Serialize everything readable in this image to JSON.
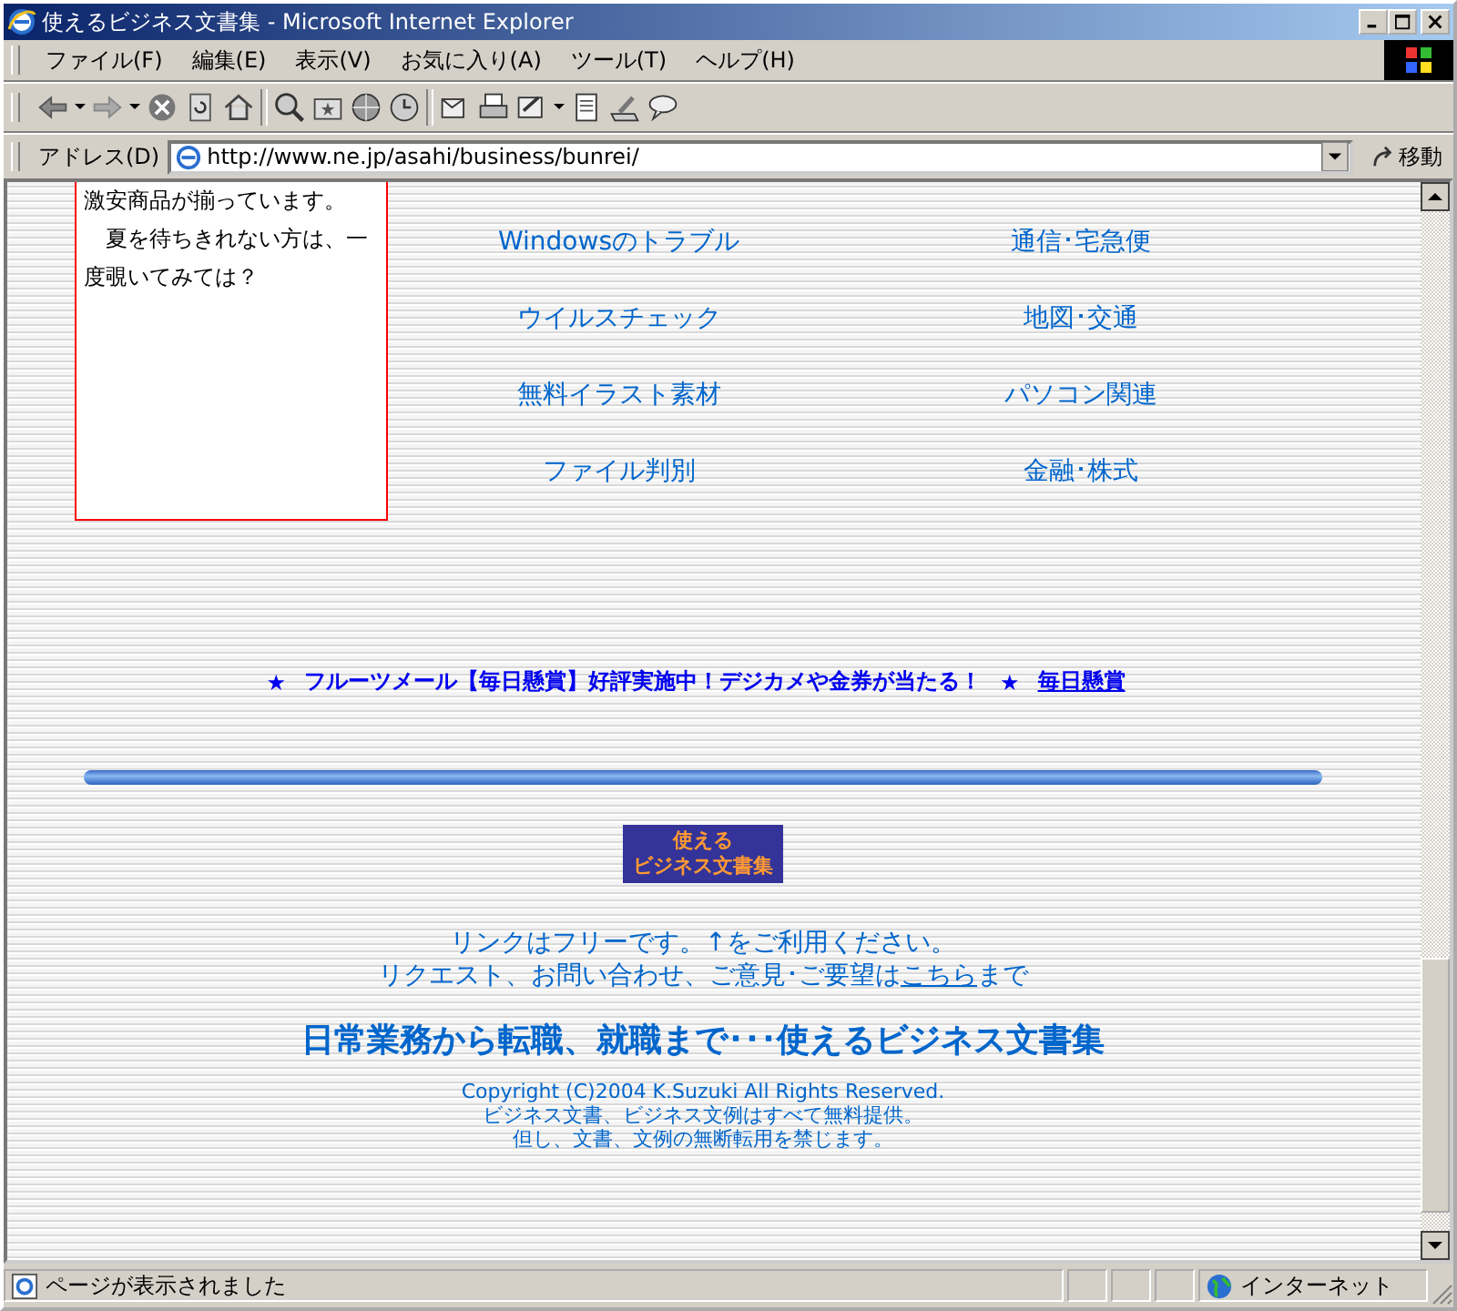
{
  "window": {
    "title": "使えるビジネス文書集 - Microsoft Internet Explorer"
  },
  "menu": [
    "ファイル(F)",
    "編集(E)",
    "表示(V)",
    "お気に入り(A)",
    "ツール(T)",
    "ヘルプ(H)"
  ],
  "address_bar": {
    "label": "アドレス(D)",
    "url": "http://www.ne.jp/asahi/business/bunrei/",
    "go": "移動"
  },
  "sidebar_note": [
    "激安商品が揃っています。",
    "　夏を待ちきれない方は、一度覗いてみては？"
  ],
  "links": [
    "Windowsのトラブル",
    "通信･宅急便",
    "ウイルスチェック",
    "地図･交通",
    "無料イラスト素材",
    "パソコン関連",
    "ファイル判別",
    "金融･株式"
  ],
  "promo": {
    "star": "★",
    "text": "フルーツメール【毎日懸賞】好評実施中！デジカメや金券が当たる！",
    "star2": "★",
    "link": "毎日懸賞"
  },
  "logo": [
    "使える",
    "ビジネス文書集"
  ],
  "footer": {
    "line1": "リンクはフリーです。↑をご利用ください。",
    "line2_before": "リクエスト、お問い合わせ、ご意見･ご要望は",
    "line2_link": "こちら",
    "line2_after": "まで",
    "headline": "日常業務から転職、就職まで･･･使えるビジネス文書集",
    "copyright": [
      "Copyright (C)2004 K.Suzuki All Rights Reserved.",
      "ビジネス文書、ビジネス文例はすべて無料提供。",
      "但し、文書、文例の無断転用を禁じます。"
    ]
  },
  "status_bar": {
    "text": "ページが表示されました",
    "zone": "インターネット"
  }
}
